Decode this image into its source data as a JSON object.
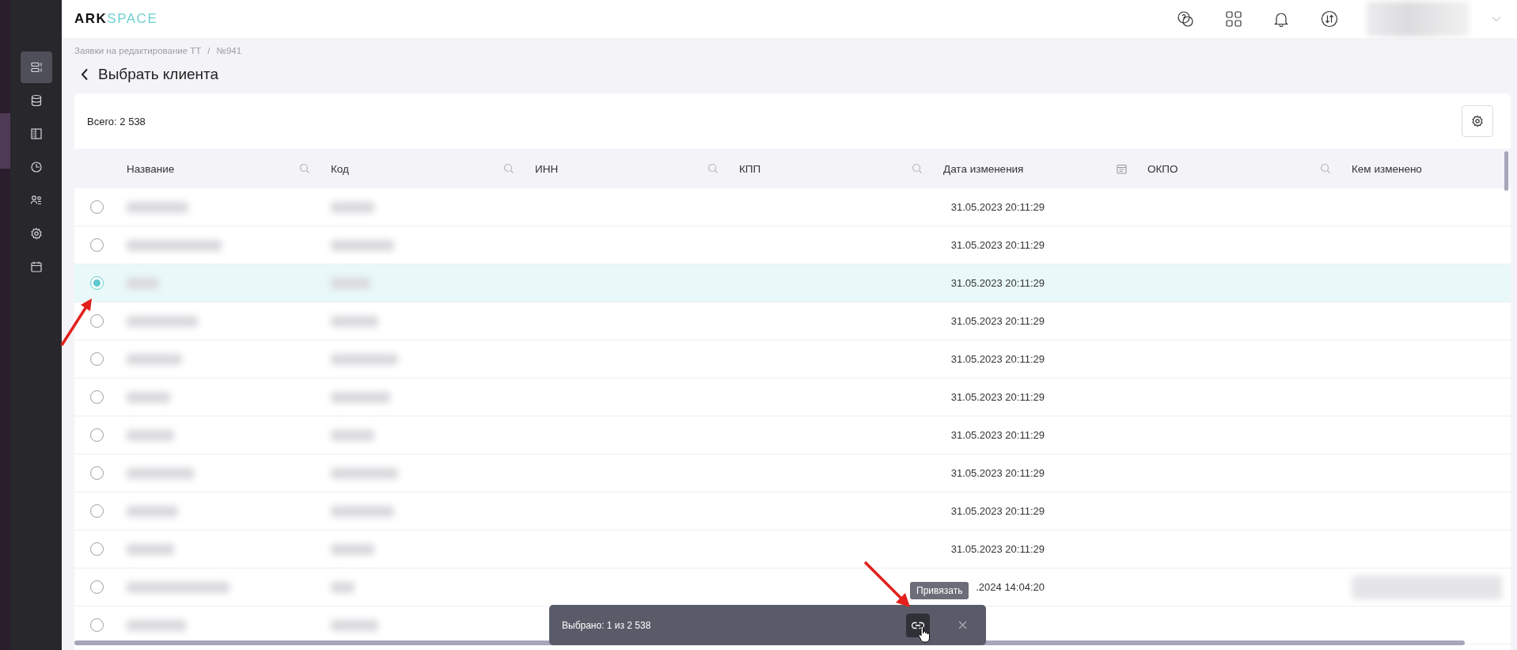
{
  "logo": {
    "dark": "ARK",
    "light": "SPACE"
  },
  "sidebar": {
    "items": [
      {
        "selected": true
      },
      {
        "selected": false
      },
      {
        "selected": false
      },
      {
        "selected": false
      },
      {
        "selected": false
      },
      {
        "selected": false
      },
      {
        "selected": false
      }
    ]
  },
  "breadcrumbs": [
    "Заявки на редактирование ТТ",
    "/",
    "№941"
  ],
  "page_title": "Выбрать клиента",
  "total": "Всего: 2 538",
  "table": {
    "columns": [
      {
        "label": "Название",
        "kind": "search"
      },
      {
        "label": "Код",
        "kind": "search"
      },
      {
        "label": "ИНН",
        "kind": "search"
      },
      {
        "label": "КПП",
        "kind": "search"
      },
      {
        "label": "Дата изменения",
        "kind": "date"
      },
      {
        "label": "ОКПО",
        "kind": "search"
      },
      {
        "label": "Кем изменено",
        "kind": "plain"
      }
    ],
    "rows": [
      {
        "selected": false,
        "date": "31.05.2023 20:11:29",
        "changed_by_hidden": false
      },
      {
        "selected": false,
        "date": "31.05.2023 20:11:29",
        "changed_by_hidden": false
      },
      {
        "selected": true,
        "date": "31.05.2023 20:11:29",
        "changed_by_hidden": false
      },
      {
        "selected": false,
        "date": "31.05.2023 20:11:29",
        "changed_by_hidden": false
      },
      {
        "selected": false,
        "date": "31.05.2023 20:11:29",
        "changed_by_hidden": false
      },
      {
        "selected": false,
        "date": "31.05.2023 20:11:29",
        "changed_by_hidden": false
      },
      {
        "selected": false,
        "date": "31.05.2023 20:11:29",
        "changed_by_hidden": false
      },
      {
        "selected": false,
        "date": "31.05.2023 20:11:29",
        "changed_by_hidden": false
      },
      {
        "selected": false,
        "date": "31.05.2023 20:11:29",
        "changed_by_hidden": false
      },
      {
        "selected": false,
        "date": "31.05.2023 20:11:29",
        "changed_by_hidden": false
      },
      {
        "selected": false,
        "date": ".2024 14:04:20",
        "changed_by_hidden": true
      },
      {
        "selected": false,
        "changed_by_hidden": false
      }
    ]
  },
  "selection_bar": {
    "text": "Выбрано: 1 из 2 538",
    "tooltip": "Привязать"
  }
}
